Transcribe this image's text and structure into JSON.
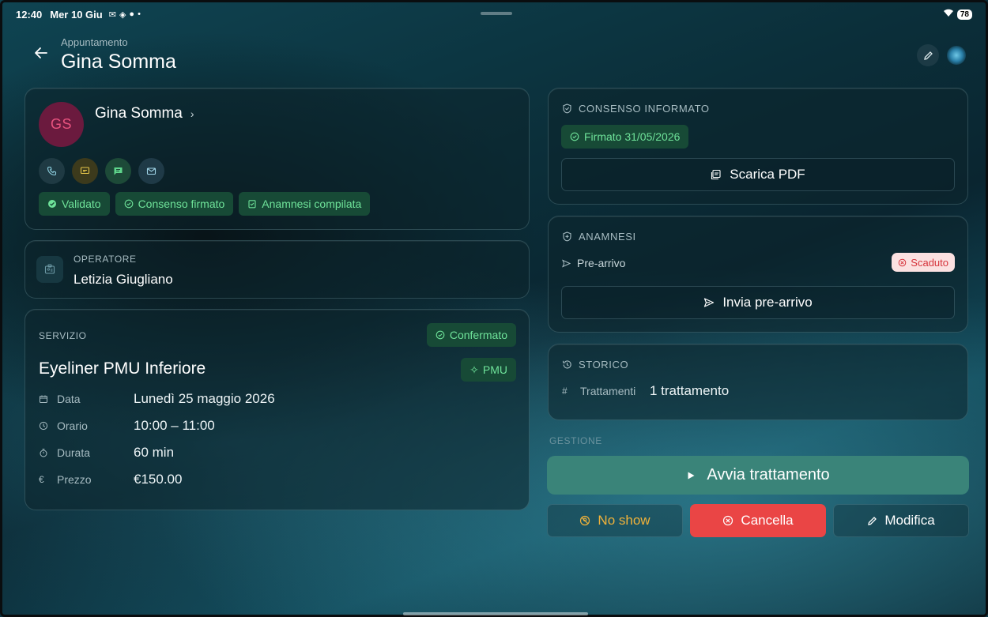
{
  "status_bar": {
    "time": "12:40",
    "date": "Mer 10 Giu",
    "battery": "78"
  },
  "header": {
    "subtitle": "Appuntamento",
    "title": "Gina Somma"
  },
  "client": {
    "initials": "GS",
    "name": "Gina Somma",
    "badges": [
      "Validato",
      "Consenso firmato",
      "Anamnesi compilata"
    ]
  },
  "operator": {
    "label": "OPERATORE",
    "name": "Letizia Giugliano"
  },
  "service": {
    "label": "SERVIZIO",
    "status": "Confermato",
    "title": "Eyeliner PMU Inferiore",
    "category": "PMU",
    "details": [
      {
        "label": "Data",
        "value": "Lunedì 25 maggio 2026"
      },
      {
        "label": "Orario",
        "value": "10:00 – 11:00"
      },
      {
        "label": "Durata",
        "value": "60 min"
      },
      {
        "label": "Prezzo",
        "value": "€150.00"
      }
    ]
  },
  "consent": {
    "heading": "CONSENSO INFORMATO",
    "signed": "Firmato 31/05/2026",
    "download_label": "Scarica PDF"
  },
  "anamnesi": {
    "heading": "ANAMNESI",
    "pre_arrivo_label": "Pre-arrivo",
    "status": "Scaduto",
    "send_label": "Invia pre-arrivo"
  },
  "storico": {
    "heading": "STORICO",
    "label": "Trattamenti",
    "value": "1 trattamento"
  },
  "gestione": {
    "label": "GESTIONE",
    "start_label": "Avvia trattamento",
    "no_show_label": "No show",
    "cancel_label": "Cancella",
    "edit_label": "Modifica"
  },
  "colors": {
    "accent_green": "#6fe39a",
    "primary_teal": "#3a8479",
    "danger": "#ea4545",
    "warning": "#f0b23a"
  }
}
